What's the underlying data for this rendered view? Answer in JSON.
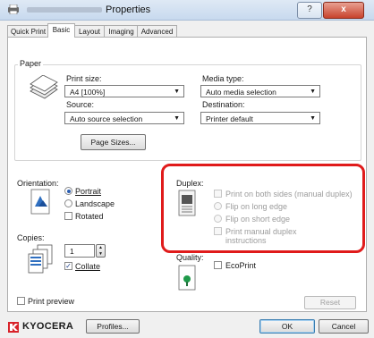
{
  "window": {
    "title": "Properties",
    "help_button": "?",
    "close_button": "x"
  },
  "tabs": [
    {
      "label": "Quick Print"
    },
    {
      "label": "Basic"
    },
    {
      "label": "Layout"
    },
    {
      "label": "Imaging"
    },
    {
      "label": "Advanced"
    }
  ],
  "paper": {
    "group_label": "Paper",
    "print_size_label": "Print size:",
    "print_size_value": "A4 [100%]",
    "media_type_label": "Media type:",
    "media_type_value": "Auto media selection",
    "source_label": "Source:",
    "source_value": "Auto source selection",
    "destination_label": "Destination:",
    "destination_value": "Printer default",
    "page_sizes_button": "Page Sizes..."
  },
  "orientation": {
    "label": "Orientation:",
    "portrait": "Portrait",
    "landscape": "Landscape",
    "rotated": "Rotated"
  },
  "copies": {
    "label": "Copies:",
    "value": "1",
    "collate": "Collate"
  },
  "duplex": {
    "label": "Duplex:",
    "print_both_sides": "Print on both sides (manual duplex)",
    "flip_long": "Flip on long edge",
    "flip_short": "Flip on short edge",
    "manual_instructions_line1": "Print manual duplex",
    "manual_instructions_line2": "instructions"
  },
  "quality": {
    "label": "Quality:",
    "ecoprint": "EcoPrint"
  },
  "footer": {
    "print_preview": "Print preview",
    "reset_button": "Reset",
    "brand": "KYOCERA",
    "profiles_button": "Profiles...",
    "ok_button": "OK",
    "cancel_button": "Cancel"
  },
  "colors": {
    "highlight_red": "#e01b1b",
    "accent_blue": "#2a5db0"
  }
}
